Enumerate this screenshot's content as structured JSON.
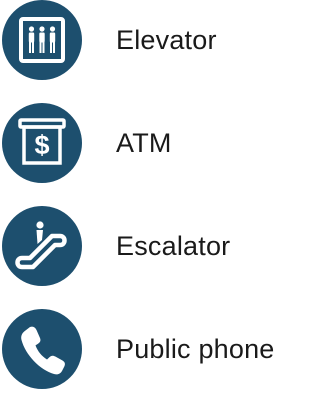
{
  "colors": {
    "icon_background": "#1d4f6e",
    "icon_foreground": "#ffffff",
    "label_text": "#1a1a1a"
  },
  "legend": {
    "items": [
      {
        "icon": "elevator-icon",
        "label": "Elevator"
      },
      {
        "icon": "atm-icon",
        "label": "ATM"
      },
      {
        "icon": "escalator-icon",
        "label": "Escalator"
      },
      {
        "icon": "phone-icon",
        "label": "Public phone"
      }
    ]
  }
}
